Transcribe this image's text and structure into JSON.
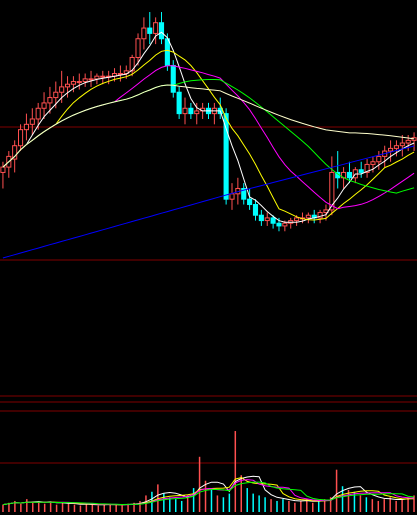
{
  "chart_data": [
    {
      "type": "candlestick",
      "panel": "price",
      "ylim": [
        0,
        100
      ],
      "candles": [
        {
          "o": 52,
          "h": 56,
          "l": 46,
          "c": 54
        },
        {
          "o": 54,
          "h": 60,
          "l": 50,
          "c": 58
        },
        {
          "o": 57,
          "h": 64,
          "l": 52,
          "c": 62
        },
        {
          "o": 62,
          "h": 70,
          "l": 60,
          "c": 68
        },
        {
          "o": 68,
          "h": 74,
          "l": 64,
          "c": 70
        },
        {
          "o": 70,
          "h": 76,
          "l": 66,
          "c": 72
        },
        {
          "o": 72,
          "h": 78,
          "l": 68,
          "c": 76
        },
        {
          "o": 76,
          "h": 82,
          "l": 72,
          "c": 78
        },
        {
          "o": 78,
          "h": 84,
          "l": 74,
          "c": 80
        },
        {
          "o": 80,
          "h": 86,
          "l": 76,
          "c": 82
        },
        {
          "o": 82,
          "h": 90,
          "l": 78,
          "c": 84
        },
        {
          "o": 84,
          "h": 88,
          "l": 80,
          "c": 85
        },
        {
          "o": 85,
          "h": 88,
          "l": 82,
          "c": 86
        },
        {
          "o": 86,
          "h": 89,
          "l": 83,
          "c": 86
        },
        {
          "o": 86,
          "h": 89,
          "l": 84,
          "c": 87
        },
        {
          "o": 87,
          "h": 90,
          "l": 84,
          "c": 87
        },
        {
          "o": 87,
          "h": 89,
          "l": 85,
          "c": 88
        },
        {
          "o": 88,
          "h": 90,
          "l": 85,
          "c": 88
        },
        {
          "o": 88,
          "h": 90,
          "l": 85,
          "c": 88
        },
        {
          "o": 88,
          "h": 91,
          "l": 86,
          "c": 89
        },
        {
          "o": 89,
          "h": 92,
          "l": 86,
          "c": 89
        },
        {
          "o": 89,
          "h": 92,
          "l": 87,
          "c": 90
        },
        {
          "o": 90,
          "h": 96,
          "l": 88,
          "c": 95
        },
        {
          "o": 95,
          "h": 104,
          "l": 92,
          "c": 102
        },
        {
          "o": 102,
          "h": 110,
          "l": 98,
          "c": 106
        },
        {
          "o": 106,
          "h": 112,
          "l": 100,
          "c": 104
        },
        {
          "o": 104,
          "h": 110,
          "l": 100,
          "c": 108
        },
        {
          "o": 108,
          "h": 112,
          "l": 100,
          "c": 102
        },
        {
          "o": 102,
          "h": 104,
          "l": 90,
          "c": 92
        },
        {
          "o": 92,
          "h": 94,
          "l": 80,
          "c": 82
        },
        {
          "o": 82,
          "h": 84,
          "l": 72,
          "c": 74
        },
        {
          "o": 74,
          "h": 80,
          "l": 70,
          "c": 76
        },
        {
          "o": 76,
          "h": 78,
          "l": 72,
          "c": 74
        },
        {
          "o": 74,
          "h": 78,
          "l": 70,
          "c": 75
        },
        {
          "o": 75,
          "h": 78,
          "l": 72,
          "c": 76
        },
        {
          "o": 76,
          "h": 78,
          "l": 72,
          "c": 74
        },
        {
          "o": 74,
          "h": 78,
          "l": 70,
          "c": 76
        },
        {
          "o": 76,
          "h": 80,
          "l": 72,
          "c": 74
        },
        {
          "o": 74,
          "h": 76,
          "l": 40,
          "c": 42
        },
        {
          "o": 42,
          "h": 48,
          "l": 38,
          "c": 44
        },
        {
          "o": 44,
          "h": 50,
          "l": 40,
          "c": 46
        },
        {
          "o": 46,
          "h": 48,
          "l": 40,
          "c": 42
        },
        {
          "o": 42,
          "h": 46,
          "l": 38,
          "c": 40
        },
        {
          "o": 40,
          "h": 42,
          "l": 34,
          "c": 36
        },
        {
          "o": 36,
          "h": 38,
          "l": 32,
          "c": 34
        },
        {
          "o": 34,
          "h": 37,
          "l": 32,
          "c": 35
        },
        {
          "o": 35,
          "h": 36,
          "l": 31,
          "c": 33
        },
        {
          "o": 33,
          "h": 35,
          "l": 30,
          "c": 32
        },
        {
          "o": 32,
          "h": 34,
          "l": 30,
          "c": 33
        },
        {
          "o": 33,
          "h": 35,
          "l": 31,
          "c": 34
        },
        {
          "o": 34,
          "h": 36,
          "l": 32,
          "c": 35
        },
        {
          "o": 35,
          "h": 37,
          "l": 33,
          "c": 35
        },
        {
          "o": 35,
          "h": 37,
          "l": 33,
          "c": 36
        },
        {
          "o": 36,
          "h": 38,
          "l": 33,
          "c": 35
        },
        {
          "o": 35,
          "h": 38,
          "l": 33,
          "c": 37
        },
        {
          "o": 37,
          "h": 40,
          "l": 34,
          "c": 38
        },
        {
          "o": 38,
          "h": 58,
          "l": 36,
          "c": 52
        },
        {
          "o": 52,
          "h": 60,
          "l": 46,
          "c": 50
        },
        {
          "o": 50,
          "h": 54,
          "l": 46,
          "c": 52
        },
        {
          "o": 52,
          "h": 56,
          "l": 48,
          "c": 50
        },
        {
          "o": 50,
          "h": 54,
          "l": 48,
          "c": 53
        },
        {
          "o": 53,
          "h": 56,
          "l": 50,
          "c": 52
        },
        {
          "o": 52,
          "h": 57,
          "l": 50,
          "c": 55
        },
        {
          "o": 55,
          "h": 58,
          "l": 52,
          "c": 56
        },
        {
          "o": 56,
          "h": 60,
          "l": 53,
          "c": 58
        },
        {
          "o": 58,
          "h": 62,
          "l": 54,
          "c": 60
        },
        {
          "o": 60,
          "h": 64,
          "l": 56,
          "c": 61
        },
        {
          "o": 61,
          "h": 64,
          "l": 58,
          "c": 62
        },
        {
          "o": 62,
          "h": 66,
          "l": 58,
          "c": 63
        },
        {
          "o": 63,
          "h": 66,
          "l": 60,
          "c": 64
        },
        {
          "o": 64,
          "h": 67,
          "l": 60,
          "c": 65
        }
      ],
      "moving_averages": [
        {
          "color": "#ffffff",
          "period": 5
        },
        {
          "color": "#ffff00",
          "period": 10
        },
        {
          "color": "#ff00ff",
          "period": 20
        },
        {
          "color": "#00ff00",
          "period": 30
        },
        {
          "color": "#ffffcc",
          "period": 60
        },
        {
          "color": "#0000ff",
          "period": 120
        }
      ],
      "reference_lines": [
        {
          "value": 68,
          "color": "#800000"
        },
        {
          "value": -2,
          "color": "#800000"
        }
      ]
    },
    {
      "type": "indicator",
      "panel": "middle",
      "reference_lines": [
        {
          "color": "#800000"
        },
        {
          "color": "#800000"
        },
        {
          "color": "#800000"
        }
      ]
    },
    {
      "type": "bar",
      "panel": "volume",
      "ylim": [
        0,
        100
      ],
      "values": [
        8,
        10,
        12,
        9,
        14,
        10,
        12,
        9,
        11,
        8,
        10,
        9,
        8,
        7,
        9,
        8,
        7,
        8,
        9,
        8,
        7,
        9,
        10,
        12,
        18,
        22,
        30,
        20,
        16,
        14,
        12,
        18,
        26,
        60,
        34,
        24,
        18,
        16,
        20,
        88,
        40,
        26,
        20,
        18,
        16,
        14,
        12,
        14,
        12,
        10,
        12,
        14,
        10,
        12,
        14,
        16,
        46,
        28,
        24,
        22,
        18,
        16,
        14,
        12,
        14,
        16,
        12,
        14,
        16,
        18
      ],
      "moving_averages": [
        {
          "color": "#ffffff",
          "period": 5
        },
        {
          "color": "#ffff00",
          "period": 10
        },
        {
          "color": "#ff00ff",
          "period": 20
        },
        {
          "color": "#00ff00",
          "period": 30
        }
      ],
      "reference_lines": [
        {
          "value": 55,
          "color": "#800000"
        }
      ]
    }
  ]
}
